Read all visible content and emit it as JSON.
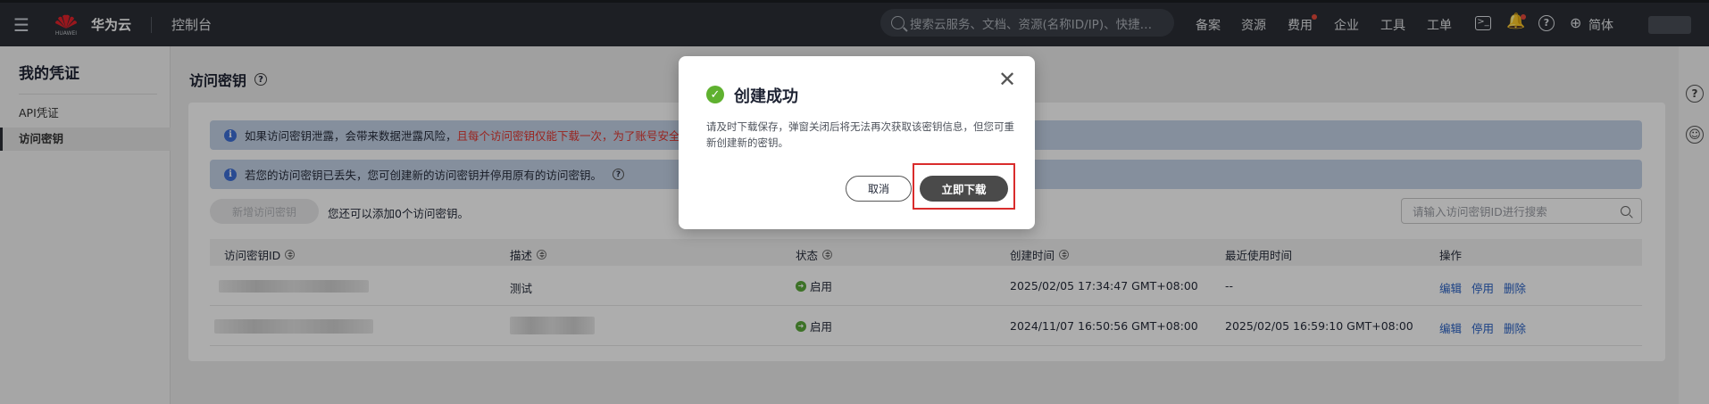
{
  "topbar": {
    "logo_text": "HUAWEI",
    "brand": "华为云",
    "console": "控制台",
    "search_placeholder": "搜索云服务、文档、资源(名称ID/IP)、快捷…",
    "nav": [
      "备案",
      "资源",
      "费用",
      "企业",
      "工具",
      "工单"
    ],
    "language": "简体"
  },
  "sidebar": {
    "title": "我的凭证",
    "items": [
      {
        "label": "API凭证",
        "active": false
      },
      {
        "label": "访问密钥",
        "active": true
      }
    ]
  },
  "main": {
    "title": "访问密钥",
    "banner1_text": "如果访问密钥泄露，会带来数据泄露风险，",
    "banner1_red": "且每个访问密钥仅能下载一次，为了账号安全性，",
    "banner2_text": "若您的访问密钥已丢失，您可创建新的访问密钥并停用原有的访问密钥。",
    "create_button": "新增访问密钥",
    "hint": "您还可以添加0个访问密钥。",
    "search_placeholder": "请输入访问密钥ID进行搜索",
    "columns": [
      "访问密钥ID",
      "描述",
      "状态",
      "创建时间",
      "最近使用时间",
      "操作"
    ],
    "rows": [
      {
        "description": "测试",
        "status": "启用",
        "created": "2025/02/05 17:34:47 GMT+08:00",
        "last_used": "--"
      },
      {
        "description": "",
        "status": "启用",
        "created": "2024/11/07 16:50:56 GMT+08:00",
        "last_used": "2025/02/05 16:59:10 GMT+08:00"
      }
    ],
    "actions": [
      "编辑",
      "停用",
      "删除"
    ]
  },
  "modal": {
    "title": "创建成功",
    "body": "请及时下载保存，弹窗关闭后将无法再次获取该密钥信息，但您可重新创建新的密钥。",
    "cancel": "取消",
    "download": "立即下载"
  },
  "colors": {
    "topbar_bg": "#2b2f36",
    "banner_bg": "#c5d3e8",
    "link": "#2760c5",
    "success": "#5fb12f",
    "highlight": "#d92c2c"
  }
}
